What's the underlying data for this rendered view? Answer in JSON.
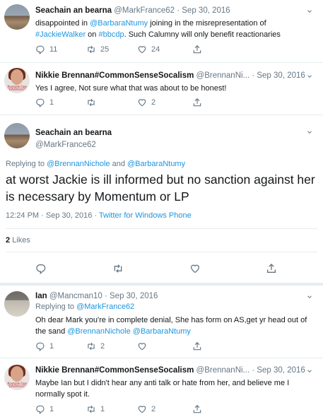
{
  "tweet1": {
    "name": "Seachain an bearna",
    "handle": "@MarkFrance62 · Sep 30, 2016",
    "text_a": "disappointed in ",
    "mention1": "@BarbaraNtumy",
    "text_b": " joining in the misrepresentation of",
    "hashtag1": "#JackieWalker",
    "text_c": " on ",
    "hashtag2": "#bbcdp",
    "text_d": ". Such Calumny will only benefit reactionaries",
    "replies": "11",
    "retweets": "25",
    "likes": "24"
  },
  "tweet2": {
    "name": "Nikkie Brennan#CommonSenseSocalism",
    "handle": "@BrennanNi... · Sep 30, 2016",
    "avatar_text": "#outside Free \"DAVDALIST\"",
    "text": "Yes I agree, Not sure what that was about to be honest!",
    "replies": "1",
    "retweets": "",
    "likes": "2"
  },
  "main": {
    "name": "Seachain an bearna",
    "handle": "@MarkFrance62",
    "replying_prefix": "Replying to ",
    "replying_to1": "@BrennanNichole",
    "replying_and": " and ",
    "replying_to2": "@BarbaraNtumy",
    "text": "at worst Jackie is ill informed but no sanction against her is necessary by Momentum or LP",
    "timestamp": "12:24 PM · Sep 30, 2016 · ",
    "source": "Twitter for Windows Phone",
    "likes_count": "2",
    "likes_label": " Likes"
  },
  "tweet3": {
    "name": "Ian",
    "handle": "@Mancman10 · Sep 30, 2016",
    "replying_prefix": "Replying to ",
    "replying_to": "@MarkFrance62",
    "text_a": "Oh dear Mark you're in complete denial, She has form on AS,get yr head out of the sand ",
    "mention1": "@BrennanNichole",
    "mention2": "@BarbaraNtumy",
    "replies": "1",
    "retweets": "2",
    "likes": ""
  },
  "tweet4": {
    "name": "Nikkie Brennan#CommonSenseSocalism",
    "handle": "@BrennanNi... · Sep 30, 2016",
    "avatar_text": "#outside Free \"DAVDALIST\"",
    "text": "Maybe Ian but I didn't hear any anti talk or hate from her, and believe me I normally spot it.",
    "replies": "1",
    "retweets": "1",
    "likes": "2"
  },
  "colors": {
    "link": "#1b95e0",
    "muted": "#657786",
    "text": "#14171a",
    "divider": "#e6ecf0"
  }
}
